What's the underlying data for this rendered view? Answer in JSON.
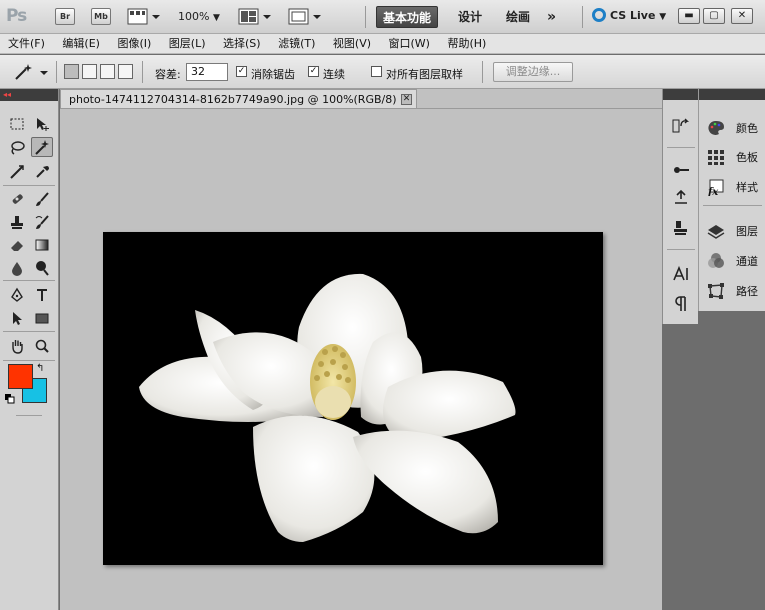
{
  "appbar": {
    "logo": "Ps",
    "bridge_label": "Br",
    "minibridge_label": "Mb",
    "zoom": "100%",
    "workspaces": [
      "基本功能",
      "设计",
      "绘画"
    ],
    "more": "»",
    "cslive": "CS Live"
  },
  "menu": [
    "文件(F)",
    "编辑(E)",
    "图像(I)",
    "图层(L)",
    "选择(S)",
    "滤镜(T)",
    "视图(V)",
    "窗口(W)",
    "帮助(H)"
  ],
  "options": {
    "tolerance_label": "容差:",
    "tolerance_value": "32",
    "antialias_label": "消除锯齿",
    "contiguous_label": "连续",
    "sample_all_label": "对所有图层取样",
    "refine_edge_label": "调整边缘..."
  },
  "document": {
    "tab_title": "photo-1474112704314-8162b7749a90.jpg @ 100%(RGB/8)"
  },
  "panels": [
    {
      "label": "颜色",
      "icon": "color-palette-icon"
    },
    {
      "label": "色板",
      "icon": "swatches-grid-icon"
    },
    {
      "label": "样式",
      "icon": "styles-fx-icon"
    },
    {
      "label": "图层",
      "icon": "layers-icon"
    },
    {
      "label": "通道",
      "icon": "channels-icon"
    },
    {
      "label": "路径",
      "icon": "paths-icon"
    }
  ],
  "colors": {
    "foreground": "#ff3300",
    "background": "#17c1e4",
    "active_workspace_bg": "#555555"
  }
}
